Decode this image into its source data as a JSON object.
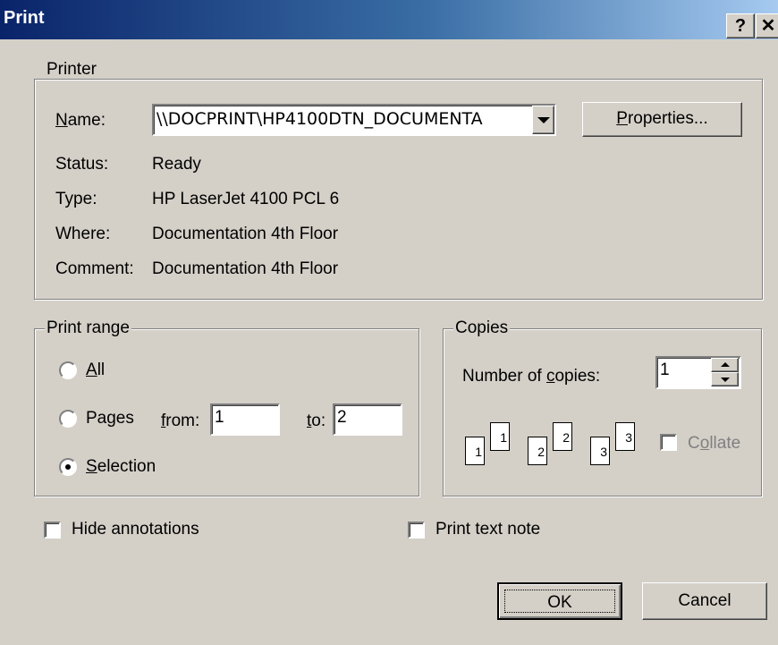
{
  "window": {
    "title": "Print",
    "help_label": "?",
    "close_label": "✕"
  },
  "printer": {
    "legend": "Printer",
    "name_label_pre": "",
    "name_label_key": "N",
    "name_label_post": "ame:",
    "name_value": "\\\\DOCPRINT\\HP4100DTN_DOCUMENTA",
    "properties_key": "P",
    "properties_rest": "roperties...",
    "status_label": "Status:",
    "status_value": "Ready",
    "type_label": "Type:",
    "type_value": "HP LaserJet 4100 PCL 6",
    "where_label": "Where:",
    "where_value": "Documentation 4th Floor",
    "comment_label": "Comment:",
    "comment_value": "Documentation 4th Floor"
  },
  "range": {
    "legend": "Print range",
    "all_key": "A",
    "all_rest": "ll",
    "pages_label": "Pages",
    "from_key": "f",
    "from_rest": "rom:",
    "from_value": "1",
    "to_key": "t",
    "to_rest": "o:",
    "to_value": "2",
    "selection_key": "S",
    "selection_rest": "election",
    "selected": "selection"
  },
  "copies": {
    "legend": "Copies",
    "count_pre": "Number of ",
    "count_key": "c",
    "count_post": "opies:",
    "count_value": "1",
    "collate_pre": "C",
    "collate_key": "o",
    "collate_post": "llate",
    "collate_checked": false,
    "page_labels": [
      "1",
      "1",
      "2",
      "2",
      "3",
      "3"
    ]
  },
  "options": {
    "hide_annotations": "Hide annotations",
    "print_text_note": "Print text note"
  },
  "buttons": {
    "ok": "OK",
    "cancel": "Cancel"
  }
}
